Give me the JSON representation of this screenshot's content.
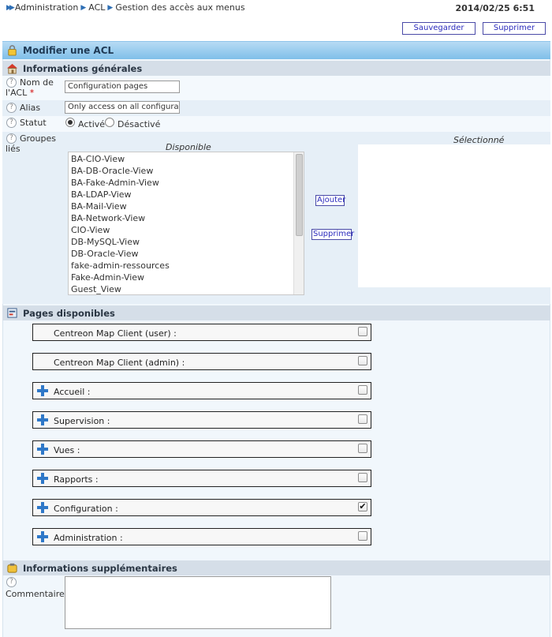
{
  "breadcrumb": [
    "Administration",
    "ACL",
    "Gestion des accès aux menus"
  ],
  "datetime": "2014/02/25 6:51",
  "buttons": {
    "save": "Sauvegarder",
    "delete": "Supprimer"
  },
  "header": {
    "title": "Modifier une ACL"
  },
  "general": {
    "title": "Informations générales",
    "name_label_1": "Nom de",
    "name_label_2": "l'ACL",
    "required_mark": "*",
    "name_value": "Configuration pages",
    "alias_label": "Alias",
    "alias_value": "Only access on all configuratio",
    "status_label": "Statut",
    "status_active": "Activé",
    "status_inactive": "Désactivé",
    "groups_label_1": "Groupes",
    "groups_label_2": "liés",
    "available_label": "Disponible",
    "selected_label": "Sélectionné",
    "available_items": [
      "BA-CIO-View",
      "BA-DB-Oracle-View",
      "BA-Fake-Admin-View",
      "BA-LDAP-View",
      "BA-Mail-View",
      "BA-Network-View",
      "CIO-View",
      "DB-MySQL-View",
      "DB-Oracle-View",
      "fake-admin-ressources",
      "Fake-Admin-View",
      "Guest_View"
    ],
    "add_button": "Ajouter",
    "remove_button": "Supprimer"
  },
  "pages": {
    "title": "Pages disponibles",
    "items": [
      {
        "label": "Centreon Map Client (user) :",
        "expandable": false,
        "checked": false
      },
      {
        "label": "Centreon Map Client (admin) :",
        "expandable": false,
        "checked": false
      },
      {
        "label": "Accueil :",
        "expandable": true,
        "checked": false
      },
      {
        "label": "Supervision :",
        "expandable": true,
        "checked": false
      },
      {
        "label": "Vues :",
        "expandable": true,
        "checked": false
      },
      {
        "label": "Rapports :",
        "expandable": true,
        "checked": false
      },
      {
        "label": "Configuration :",
        "expandable": true,
        "checked": true
      },
      {
        "label": "Administration :",
        "expandable": true,
        "checked": false
      }
    ]
  },
  "extra": {
    "title": "Informations supplémentaires",
    "comments_label": "Commentaires",
    "comments_value": ""
  },
  "icons": {
    "help": "?",
    "check": "✔"
  }
}
